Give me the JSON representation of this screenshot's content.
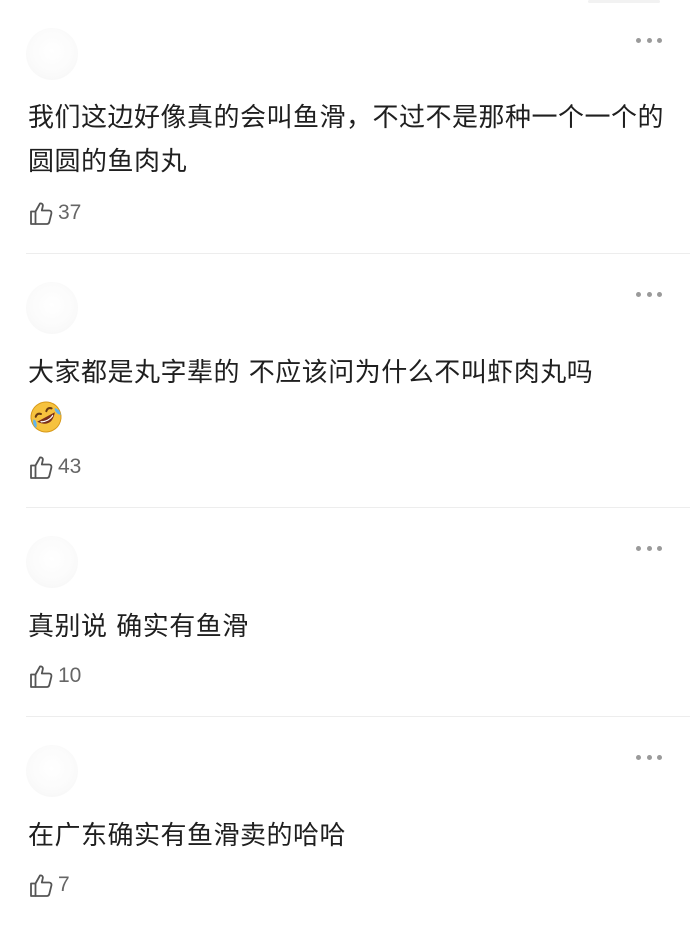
{
  "comments": [
    {
      "text": "我们这边好像真的会叫鱼滑，不过不是那种一个一个的圆圆的鱼肉丸",
      "likes": "37",
      "like_icon": "thumbs-up-icon",
      "more_icon": "more-options-icon"
    },
    {
      "text": "大家都是丸字辈的 不应该问为什么不叫虾肉丸吗",
      "emoji": "rolling-on-floor-laughing-emoji",
      "likes": "43",
      "like_icon": "thumbs-up-icon",
      "more_icon": "more-options-icon"
    },
    {
      "text": "真别说 确实有鱼滑",
      "likes": "10",
      "like_icon": "thumbs-up-icon",
      "more_icon": "more-options-icon"
    },
    {
      "text": "在广东确实有鱼滑卖的哈哈",
      "likes": "7",
      "like_icon": "thumbs-up-icon",
      "more_icon": "more-options-icon"
    }
  ],
  "colors": {
    "text": "#1f1f1f",
    "secondary": "#666666",
    "divider": "#ededed",
    "more_dots": "#9a9a9a"
  }
}
